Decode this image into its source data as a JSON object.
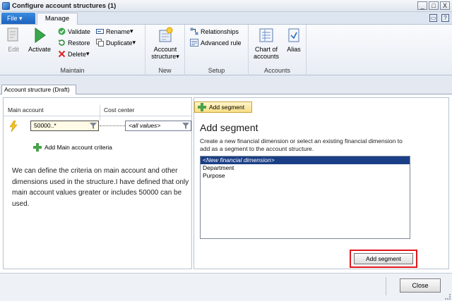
{
  "window": {
    "title": "Configure account structures (1)",
    "controls": [
      "_",
      "□",
      "X"
    ]
  },
  "ribbon_tabs": {
    "file": "File",
    "manage": "Manage"
  },
  "ribbon": {
    "maintain": {
      "label": "Maintain",
      "edit": "Edit",
      "activate": "Activate",
      "validate": "Validate",
      "restore": "Restore",
      "delete": "Delete",
      "rename": "Rename",
      "duplicate": "Duplicate"
    },
    "new": {
      "label": "New",
      "account_structure_line1": "Account",
      "account_structure_line2": "structure"
    },
    "setup": {
      "label": "Setup",
      "relationships": "Relationships",
      "advanced_rule": "Advanced rule"
    },
    "accounts": {
      "label": "Accounts",
      "chart_line1": "Chart of",
      "chart_line2": "accounts",
      "alias": "Alias"
    }
  },
  "doc_tab": "Account structure (Draft)",
  "grid": {
    "col_main": "Main account",
    "col_cost": "Cost center",
    "main_value": "50000..*",
    "cost_value": "<all values>",
    "add_criteria": "Add Main account criteria",
    "note": "We can define the criteria on main account and other dimensions used in the structure.I have defined that only main account values greater or includes 50000 can be used."
  },
  "segment": {
    "tab_label": "Add segment",
    "title": "Add segment",
    "description": "Create a new financial dimension or select an existing financial dimension to add as a segment to the account structure.",
    "items": [
      "<New financial dimension>",
      "Department",
      "Purpose"
    ],
    "add_button": "Add segment"
  },
  "footer": {
    "close": "Close"
  }
}
